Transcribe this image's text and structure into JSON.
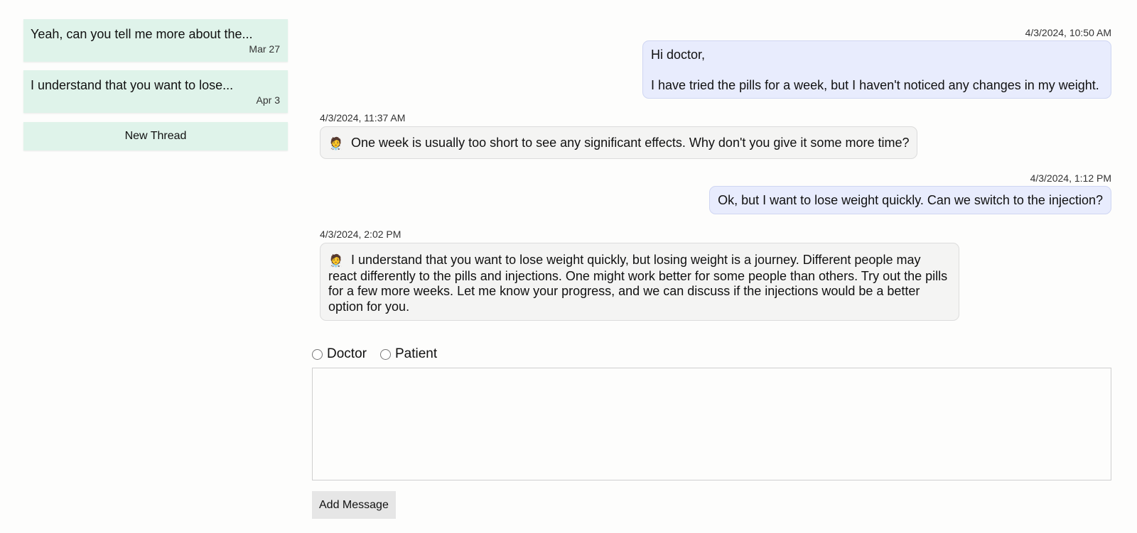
{
  "sidebar": {
    "threads": [
      {
        "preview": "Yeah, can you tell me more about the...",
        "date": "Mar 27"
      },
      {
        "preview": "I understand that you want to lose...",
        "date": "Apr 3"
      }
    ],
    "new_thread_label": "New Thread"
  },
  "messages": [
    {
      "role": "patient",
      "timestamp": "4/3/2024, 10:50 AM",
      "line1": "Hi doctor,",
      "line2": "I have tried the pills for a week, but I haven't noticed any changes in my weight."
    },
    {
      "role": "doctor",
      "timestamp": "4/3/2024, 11:37 AM",
      "emoji": "🧑‍⚕️",
      "text": "One week is usually too short to see any significant effects. Why don't you give it some more time?"
    },
    {
      "role": "patient",
      "timestamp": "4/3/2024, 1:12 PM",
      "text": "Ok, but I want to lose weight quickly. Can we switch to the injection?"
    },
    {
      "role": "doctor",
      "timestamp": "4/3/2024, 2:02 PM",
      "emoji": "🧑‍⚕️",
      "text": "I understand that you want to lose weight quickly, but losing weight is a journey. Different people may react differently to the pills and injections. One might work better for some people than others. Try out the pills for a few more weeks. Let me know your progress, and we can discuss if the injections would be a better option for you."
    }
  ],
  "composer": {
    "roles": [
      "Doctor",
      "Patient"
    ],
    "message_value": "",
    "add_button_label": "Add Message"
  },
  "colors": {
    "thread_bg": "#dff3ea",
    "patient_bubble": "#e8ecfd",
    "doctor_bubble": "#f4f4f3",
    "page_bg": "#fdfdfc"
  },
  "icons": {
    "doctor_avatar": "health-worker-emoji"
  }
}
